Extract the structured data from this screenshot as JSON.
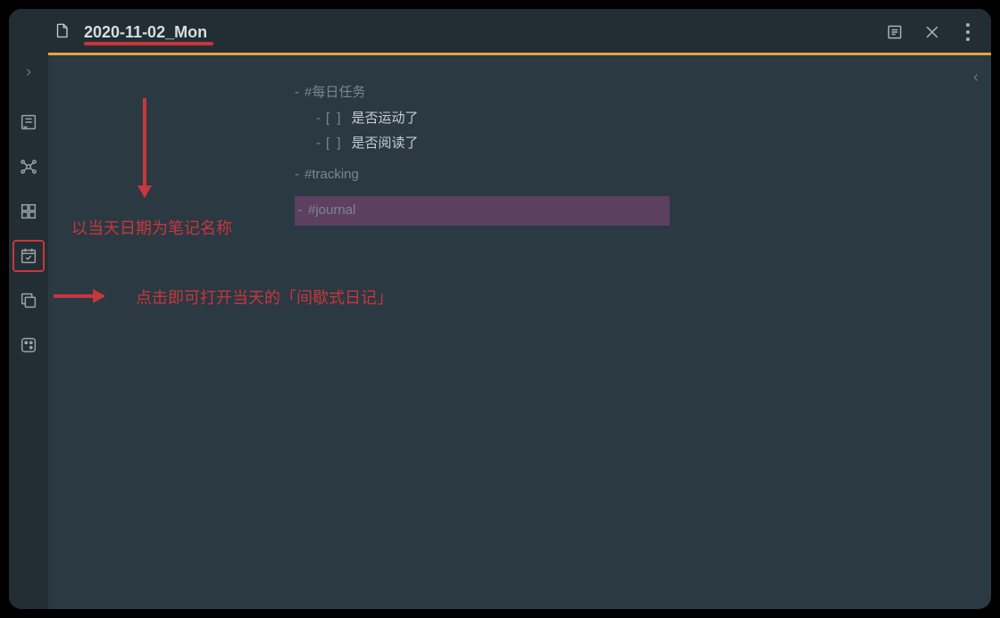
{
  "titlebar": {
    "file_title": "2020-11-02_Mon"
  },
  "note": {
    "tag_daily": "#每日任务",
    "task_exercise": "是否运动了",
    "task_read": "是否阅读了",
    "tag_tracking": "#tracking",
    "tag_journal": "#journal",
    "checkbox_marker": "[ ]",
    "bullet": "-"
  },
  "annotations": {
    "title_note": "以当天日期为笔记名称",
    "daily_note_click": "点击即可打开当天的「间歇式日记」"
  },
  "colors": {
    "accent": "#e8a33c",
    "annotation": "#c8363d",
    "highlight": "#5d3f62",
    "bg_main": "#2a3942",
    "bg_bar": "#232e34"
  },
  "ribbon": {
    "items": [
      {
        "name": "file-explorer-icon"
      },
      {
        "name": "graph-view-icon"
      },
      {
        "name": "plugins-icon"
      },
      {
        "name": "daily-note-icon",
        "selected": true
      },
      {
        "name": "copy-icon"
      },
      {
        "name": "random-note-icon"
      }
    ]
  }
}
